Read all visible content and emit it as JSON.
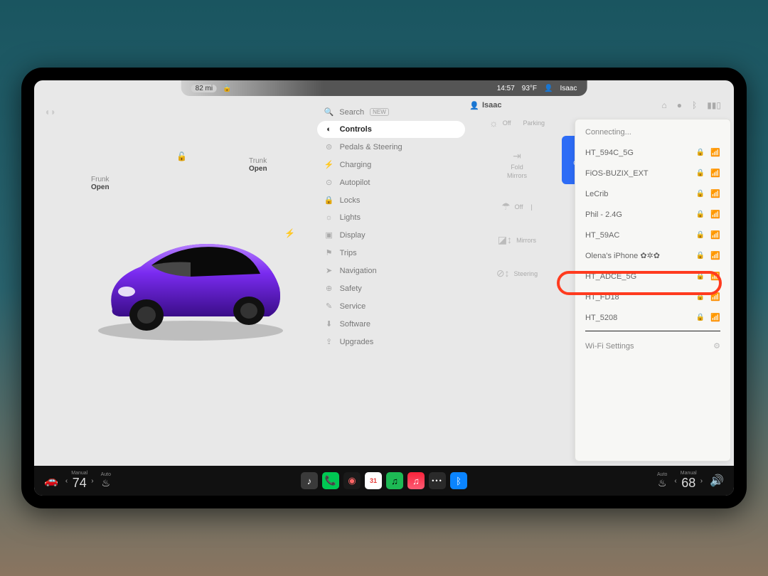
{
  "status": {
    "range": "82 mi",
    "time": "14:57",
    "temp": "93°F",
    "driver": "Isaac"
  },
  "car": {
    "frunk_label": "Frunk",
    "frunk_state": "Open",
    "trunk_label": "Trunk",
    "trunk_state": "Open"
  },
  "settings": {
    "search_label": "Search",
    "new_badge": "NEW",
    "items": [
      {
        "icon": "◐",
        "label": "Controls",
        "active": true
      },
      {
        "icon": "⊜",
        "label": "Pedals & Steering"
      },
      {
        "icon": "⚡",
        "label": "Charging"
      },
      {
        "icon": "⊙",
        "label": "Autopilot"
      },
      {
        "icon": "🔒",
        "label": "Locks"
      },
      {
        "icon": "☼",
        "label": "Lights"
      },
      {
        "icon": "▣",
        "label": "Display"
      },
      {
        "icon": "⚑",
        "label": "Trips"
      },
      {
        "icon": "➤",
        "label": "Navigation"
      },
      {
        "icon": "⊕",
        "label": "Safety"
      },
      {
        "icon": "✎",
        "label": "Service"
      },
      {
        "icon": "⬇",
        "label": "Software"
      },
      {
        "icon": "⇪",
        "label": "Upgrades"
      }
    ]
  },
  "mid": {
    "lights_off": "Off",
    "parking_label": "Parking",
    "fold_label": "Fold",
    "mirrors_label1": "Mirrors",
    "wipers_off": "Off",
    "mirrors_label2": "Mirrors",
    "steering_label": "Steering",
    "child_text": "Child"
  },
  "right": {
    "driver": "Isaac"
  },
  "wifi": {
    "status": "Connecting...",
    "networks": [
      {
        "name": "HT_594C_5G"
      },
      {
        "name": "FiOS-BUZIX_EXT"
      },
      {
        "name": "LeCrib"
      },
      {
        "name": "Phil - 2.4G"
      },
      {
        "name": "HT_59AC"
      },
      {
        "name": "Olena's iPhone ✿✲✿",
        "highlight": true
      },
      {
        "name": "HT_ADCE_5G"
      },
      {
        "name": "HT_FD18"
      },
      {
        "name": "HT_5208"
      }
    ],
    "settings_label": "Wi-Fi Settings"
  },
  "dock": {
    "left_mode": "Manual",
    "left_temp": "74",
    "auto_label": "Auto",
    "right_mode": "Manual",
    "right_temp": "68"
  }
}
